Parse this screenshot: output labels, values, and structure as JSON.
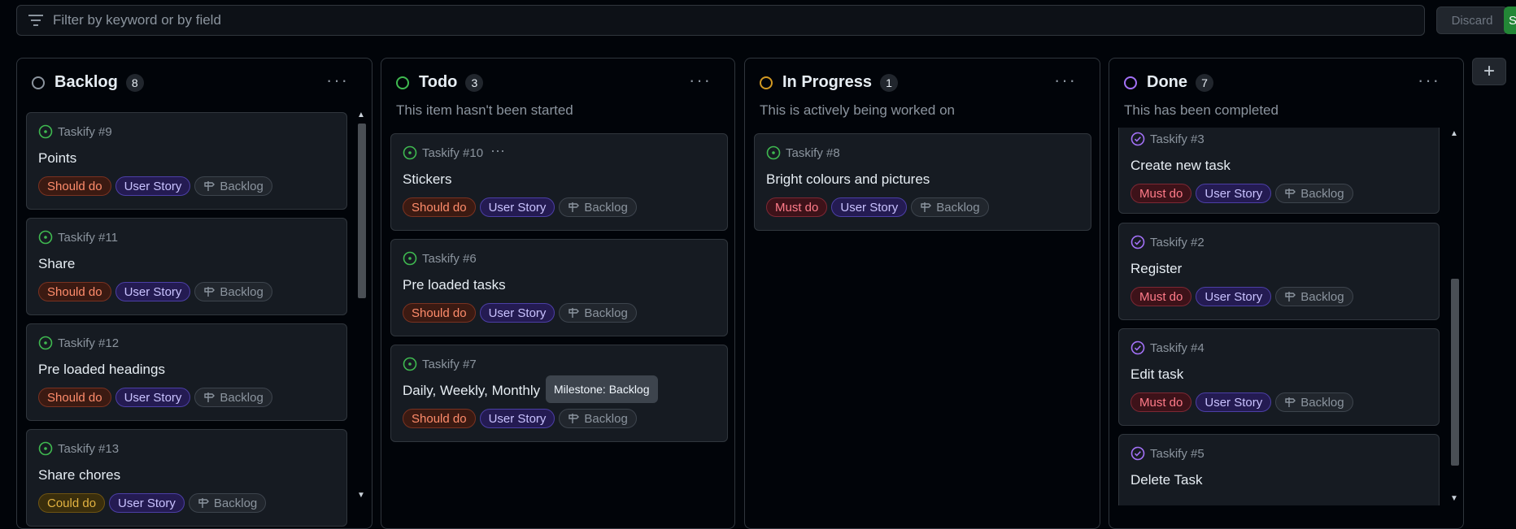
{
  "filter": {
    "placeholder": "Filter by keyword or by field"
  },
  "buttons": {
    "discard": "Discard",
    "save": "S",
    "add_column": "+"
  },
  "colors": {
    "open_issue": "#3fb950",
    "closed_issue": "#a371f7"
  },
  "columns": [
    {
      "title": "Backlog",
      "count": "8",
      "menu": "···",
      "status_color": "#8b949e",
      "cards": [
        {
          "ref": "Taskify #9",
          "title": "Points",
          "labels": [
            "Should do",
            "User Story",
            "Backlog"
          ]
        },
        {
          "ref": "Taskify #11",
          "title": "Share",
          "labels": [
            "Should do",
            "User Story",
            "Backlog"
          ]
        },
        {
          "ref": "Taskify #12",
          "title": "Pre loaded headings",
          "labels": [
            "Should do",
            "User Story",
            "Backlog"
          ]
        },
        {
          "ref": "Taskify #13",
          "title": "Share chores",
          "labels": [
            "Could do",
            "User Story",
            "Backlog"
          ]
        }
      ]
    },
    {
      "title": "Todo",
      "count": "3",
      "menu": "···",
      "status_color": "#3fb950",
      "description": "This item hasn't been started",
      "cards": [
        {
          "ref": "Taskify #10",
          "title": "Stickers",
          "labels": [
            "Should do",
            "User Story",
            "Backlog"
          ],
          "menu": "···"
        },
        {
          "ref": "Taskify #6",
          "title": "Pre loaded tasks",
          "labels": [
            "Should do",
            "User Story",
            "Backlog"
          ]
        },
        {
          "ref": "Taskify #7",
          "title": "Daily, Weekly, Monthly",
          "labels": [
            "Should do",
            "User Story",
            "Backlog"
          ]
        }
      ]
    },
    {
      "title": "In Progress",
      "count": "1",
      "menu": "···",
      "status_color": "#d29922",
      "description": "This is actively being worked on",
      "cards": [
        {
          "ref": "Taskify #8",
          "title": "Bright colours and pictures",
          "labels": [
            "Must do",
            "User Story",
            "Backlog"
          ]
        }
      ]
    },
    {
      "title": "Done",
      "count": "7",
      "menu": "···",
      "status_color": "#a371f7",
      "description": "This has been completed",
      "cards": [
        {
          "ref": "Taskify #3",
          "title": "Create new task",
          "labels": [
            "Must do",
            "User Story",
            "Backlog"
          ]
        },
        {
          "ref": "Taskify #2",
          "title": "Register",
          "labels": [
            "Must do",
            "User Story",
            "Backlog"
          ]
        },
        {
          "ref": "Taskify #4",
          "title": "Edit task",
          "labels": [
            "Must do",
            "User Story",
            "Backlog"
          ]
        },
        {
          "ref": "Taskify #5",
          "title": "Delete Task",
          "labels": []
        }
      ]
    }
  ],
  "tooltip": "Milestone: Backlog",
  "icons": {
    "filter": "filter-icon",
    "open": "issue-open-icon",
    "closed": "issue-closed-icon",
    "milestone": "milestone-icon",
    "menu": "kebab-horizontal-icon"
  }
}
